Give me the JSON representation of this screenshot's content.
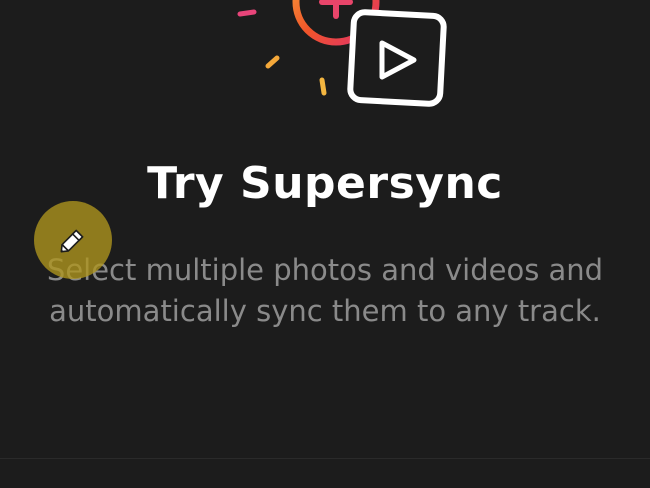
{
  "screen": {
    "title": "Try Supersync",
    "description": "Select multiple photos and videos and automatically sync them to any track."
  },
  "colors": {
    "background": "#1c1c1c",
    "title": "#ffffff",
    "description": "#8a8a8a",
    "badge": "#b0961e",
    "gradient_start": "#f47f22",
    "gradient_end": "#e1306c"
  },
  "icons": {
    "hero_record": "record-plus-icon",
    "hero_video": "video-play-icon",
    "badge": "pencil-icon"
  }
}
